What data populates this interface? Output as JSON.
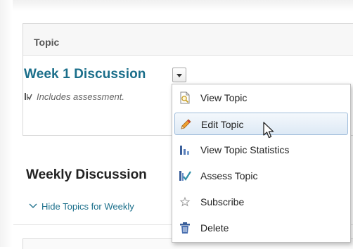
{
  "topic_panel": {
    "header_label": "Topic",
    "topic_title": "Week 1 Discussion",
    "assessment_note": "Includes assessment."
  },
  "weekly_section": {
    "title": "Weekly Discussion",
    "hide_topics_link": "Hide Topics for Weekly"
  },
  "context_menu": {
    "items": [
      {
        "label": "View Topic",
        "icon": "view-topic-icon"
      },
      {
        "label": "Edit Topic",
        "icon": "pencil-icon",
        "hovered": true
      },
      {
        "label": "View Topic Statistics",
        "icon": "statistics-icon"
      },
      {
        "label": "Assess Topic",
        "icon": "assess-icon"
      },
      {
        "label": "Subscribe",
        "icon": "star-icon"
      },
      {
        "label": "Delete",
        "icon": "trash-icon"
      }
    ]
  },
  "colors": {
    "link": "#1a6e8a",
    "hover_background": "#dde9f5",
    "hover_border": "#9fbcdb"
  }
}
